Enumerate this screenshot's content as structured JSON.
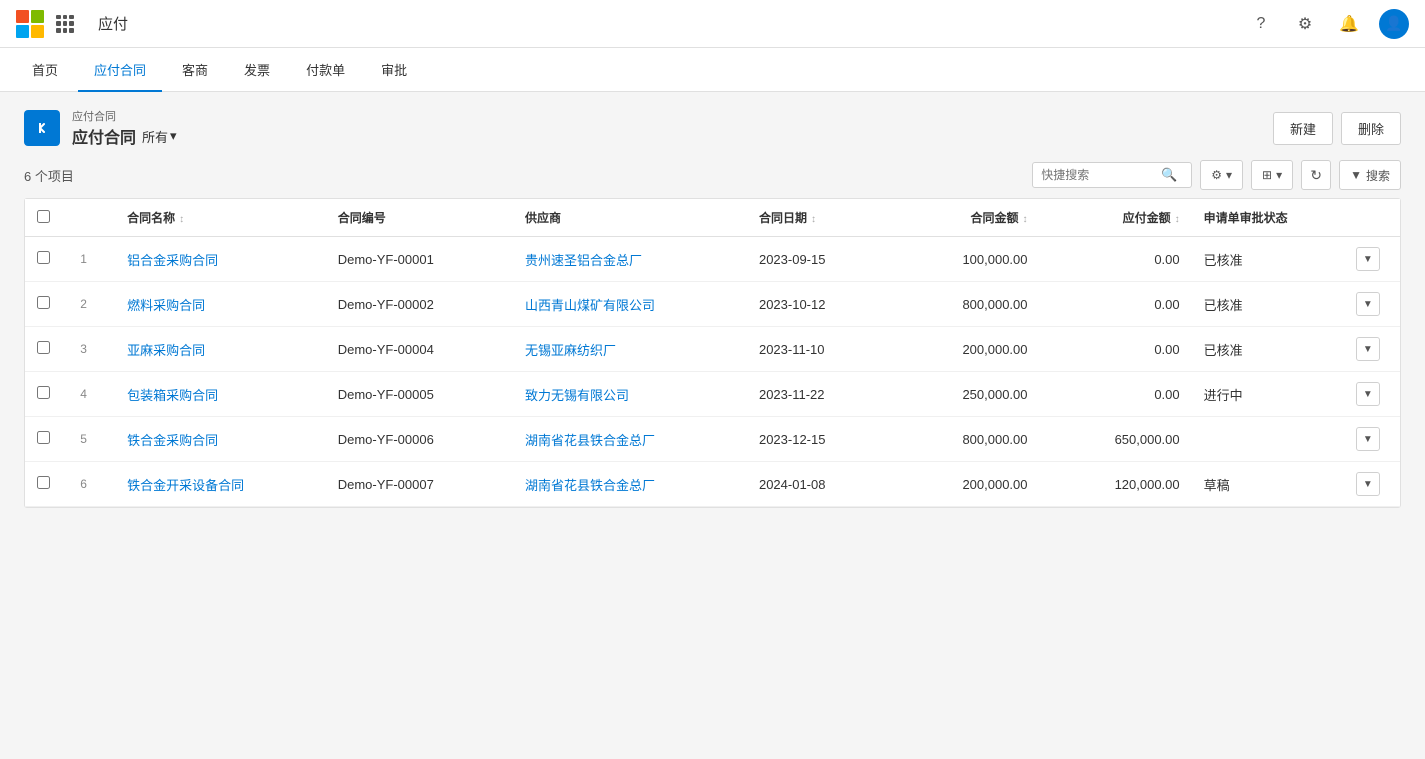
{
  "topBar": {
    "appName": "应付",
    "icons": {
      "help": "?",
      "settings": "⚙",
      "notifications": "🔔",
      "avatar": "👤"
    }
  },
  "nav": {
    "items": [
      {
        "label": "首页",
        "active": false
      },
      {
        "label": "应付合同",
        "active": true
      },
      {
        "label": "客商",
        "active": false
      },
      {
        "label": "发票",
        "active": false
      },
      {
        "label": "付款单",
        "active": false
      },
      {
        "label": "审批",
        "active": false
      }
    ]
  },
  "page": {
    "breadcrumb": "应付合同",
    "title": "应付合同",
    "filter": "所有",
    "itemCount": "6 个项目",
    "buttons": {
      "create": "新建",
      "delete": "删除"
    }
  },
  "toolbar": {
    "searchPlaceholder": "快捷搜索",
    "settingsLabel": "",
    "viewLabel": "",
    "refreshLabel": "↻",
    "filterLabel": "▼ 搜索"
  },
  "table": {
    "columns": [
      {
        "key": "name",
        "label": "合同名称",
        "sortable": true
      },
      {
        "key": "code",
        "label": "合同编号",
        "sortable": false
      },
      {
        "key": "supplier",
        "label": "供应商",
        "sortable": false
      },
      {
        "key": "date",
        "label": "合同日期",
        "sortable": true
      },
      {
        "key": "amount",
        "label": "合同金额",
        "sortable": true
      },
      {
        "key": "payable",
        "label": "应付金额",
        "sortable": true
      },
      {
        "key": "status",
        "label": "申请单审批状态",
        "sortable": false
      }
    ],
    "rows": [
      {
        "num": 1,
        "name": "铝合金采购合同",
        "code": "Demo-YF-00001",
        "supplier": "贵州速圣铝合金总厂",
        "date": "2023-09-15",
        "amount": "100,000.00",
        "payable": "0.00",
        "status": "已核准"
      },
      {
        "num": 2,
        "name": "燃料采购合同",
        "code": "Demo-YF-00002",
        "supplier": "山西青山煤矿有限公司",
        "date": "2023-10-12",
        "amount": "800,000.00",
        "payable": "0.00",
        "status": "已核准"
      },
      {
        "num": 3,
        "name": "亚麻采购合同",
        "code": "Demo-YF-00004",
        "supplier": "无锡亚麻纺织厂",
        "date": "2023-11-10",
        "amount": "200,000.00",
        "payable": "0.00",
        "status": "已核准"
      },
      {
        "num": 4,
        "name": "包装箱采购合同",
        "code": "Demo-YF-00005",
        "supplier": "致力无锡有限公司",
        "date": "2023-11-22",
        "amount": "250,000.00",
        "payable": "0.00",
        "status": "进行中"
      },
      {
        "num": 5,
        "name": "铁合金采购合同",
        "code": "Demo-YF-00006",
        "supplier": "湖南省花县铁合金总厂",
        "date": "2023-12-15",
        "amount": "800,000.00",
        "payable": "650,000.00",
        "status": ""
      },
      {
        "num": 6,
        "name": "铁合金开采设备合同",
        "code": "Demo-YF-00007",
        "supplier": "湖南省花县铁合金总厂",
        "date": "2024-01-08",
        "amount": "200,000.00",
        "payable": "120,000.00",
        "status": "草稿"
      }
    ]
  }
}
